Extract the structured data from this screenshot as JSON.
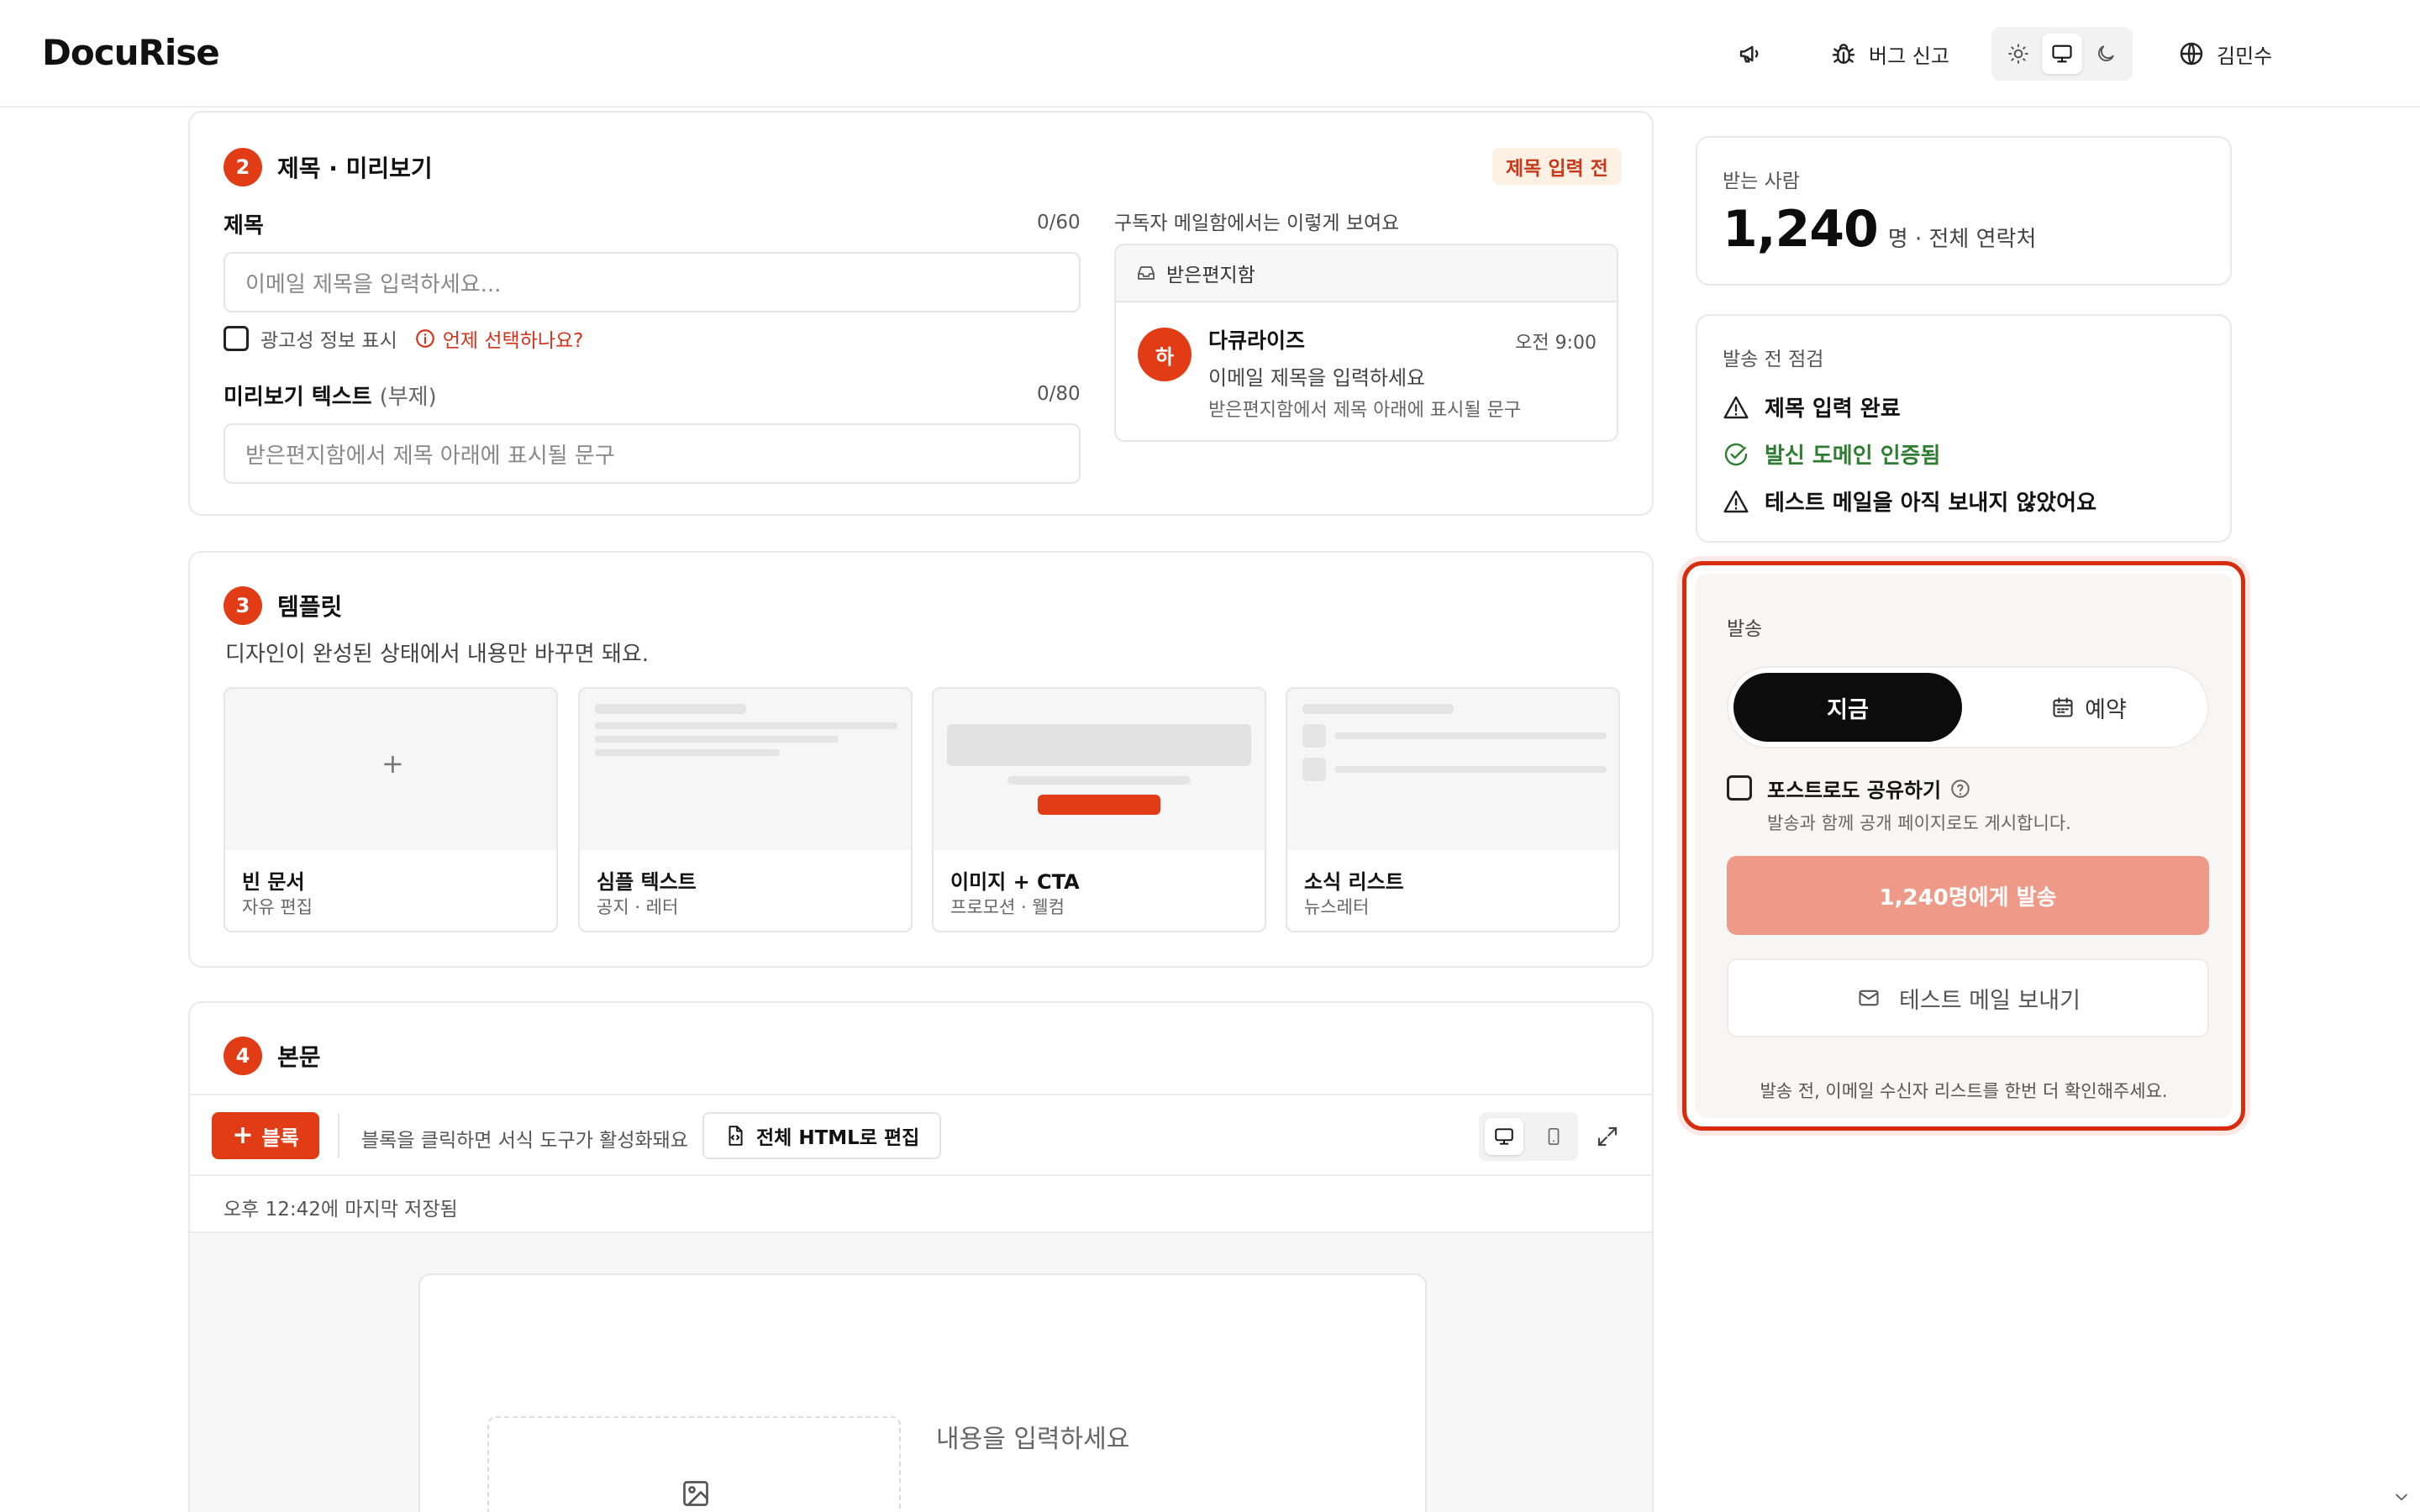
{
  "header": {
    "logo": "DocuRise",
    "bug_report": "버그 신고",
    "user_name": "김민수"
  },
  "step2": {
    "number": "2",
    "title": "제목 · 미리보기",
    "status_badge": "제목 입력 전",
    "subject_label": "제목",
    "subject_counter": "0/60",
    "subject_placeholder": "이메일 제목을 입력하세요...",
    "ad_checkbox_label": "광고성 정보 표시",
    "ad_help_link": "언제 선택하나요?",
    "preview_label": "미리보기 텍스트",
    "preview_label_sub": "(부제)",
    "preview_counter": "0/80",
    "preview_placeholder": "받은편지함에서 제목 아래에 표시될 문구",
    "inbox_caption": "구독자 메일함에서는 이렇게 보여요",
    "inbox_header": "받은편지함",
    "sender_avatar": "하",
    "sender_name": "다큐라이즈",
    "sender_time": "오전 9:00",
    "preview_subject": "이메일 제목을 입력하세요",
    "preview_body": "받은편지함에서 제목 아래에 표시될 문구"
  },
  "step3": {
    "number": "3",
    "title": "템플릿",
    "description": "디자인이 완성된 상태에서 내용만 바꾸면 돼요.",
    "templates": [
      {
        "name": "빈 문서",
        "sub": "자유 편집"
      },
      {
        "name": "심플 텍스트",
        "sub": "공지 · 레터"
      },
      {
        "name": "이미지 + CTA",
        "sub": "프로모션 · 웰컴"
      },
      {
        "name": "소식 리스트",
        "sub": "뉴스레터"
      }
    ]
  },
  "step4": {
    "number": "4",
    "title": "본문",
    "block_button": "블록",
    "toolbar_hint": "블록을 클릭하면 서식 도구가 활성화돼요",
    "html_edit_button": "전체 HTML로 편집",
    "saved_status": "오후 12:42에 마지막 저장됨",
    "content_placeholder": "내용을 입력하세요"
  },
  "recipients": {
    "label": "받는 사람",
    "count": "1,240",
    "suffix": "명 · 전체 연락처"
  },
  "precheck": {
    "title": "발송 전 점검",
    "items": [
      {
        "text": "제목 입력 완료",
        "status": "warning"
      },
      {
        "text": "발신 도메인 인증됨",
        "status": "ok"
      },
      {
        "text": "테스트 메일을 아직 보내지 않았어요",
        "status": "warning"
      }
    ]
  },
  "send": {
    "title": "발송",
    "now_label": "지금",
    "schedule_label": "예약",
    "post_share_label": "포스트로도 공유하기",
    "post_share_desc": "발송과 함께 공개 페이지로도 게시합니다.",
    "send_button": "1,240명에게 발송",
    "test_button": "테스트 메일 보내기",
    "footer_note": "발송 전, 이메일 수신자 리스트를 한번 더 확인해주세요."
  },
  "colors": {
    "accent": "#e13c16",
    "ok": "#2e7d32",
    "highlight_border": "#d92b0d",
    "send_disabled": "#ef9a88"
  }
}
